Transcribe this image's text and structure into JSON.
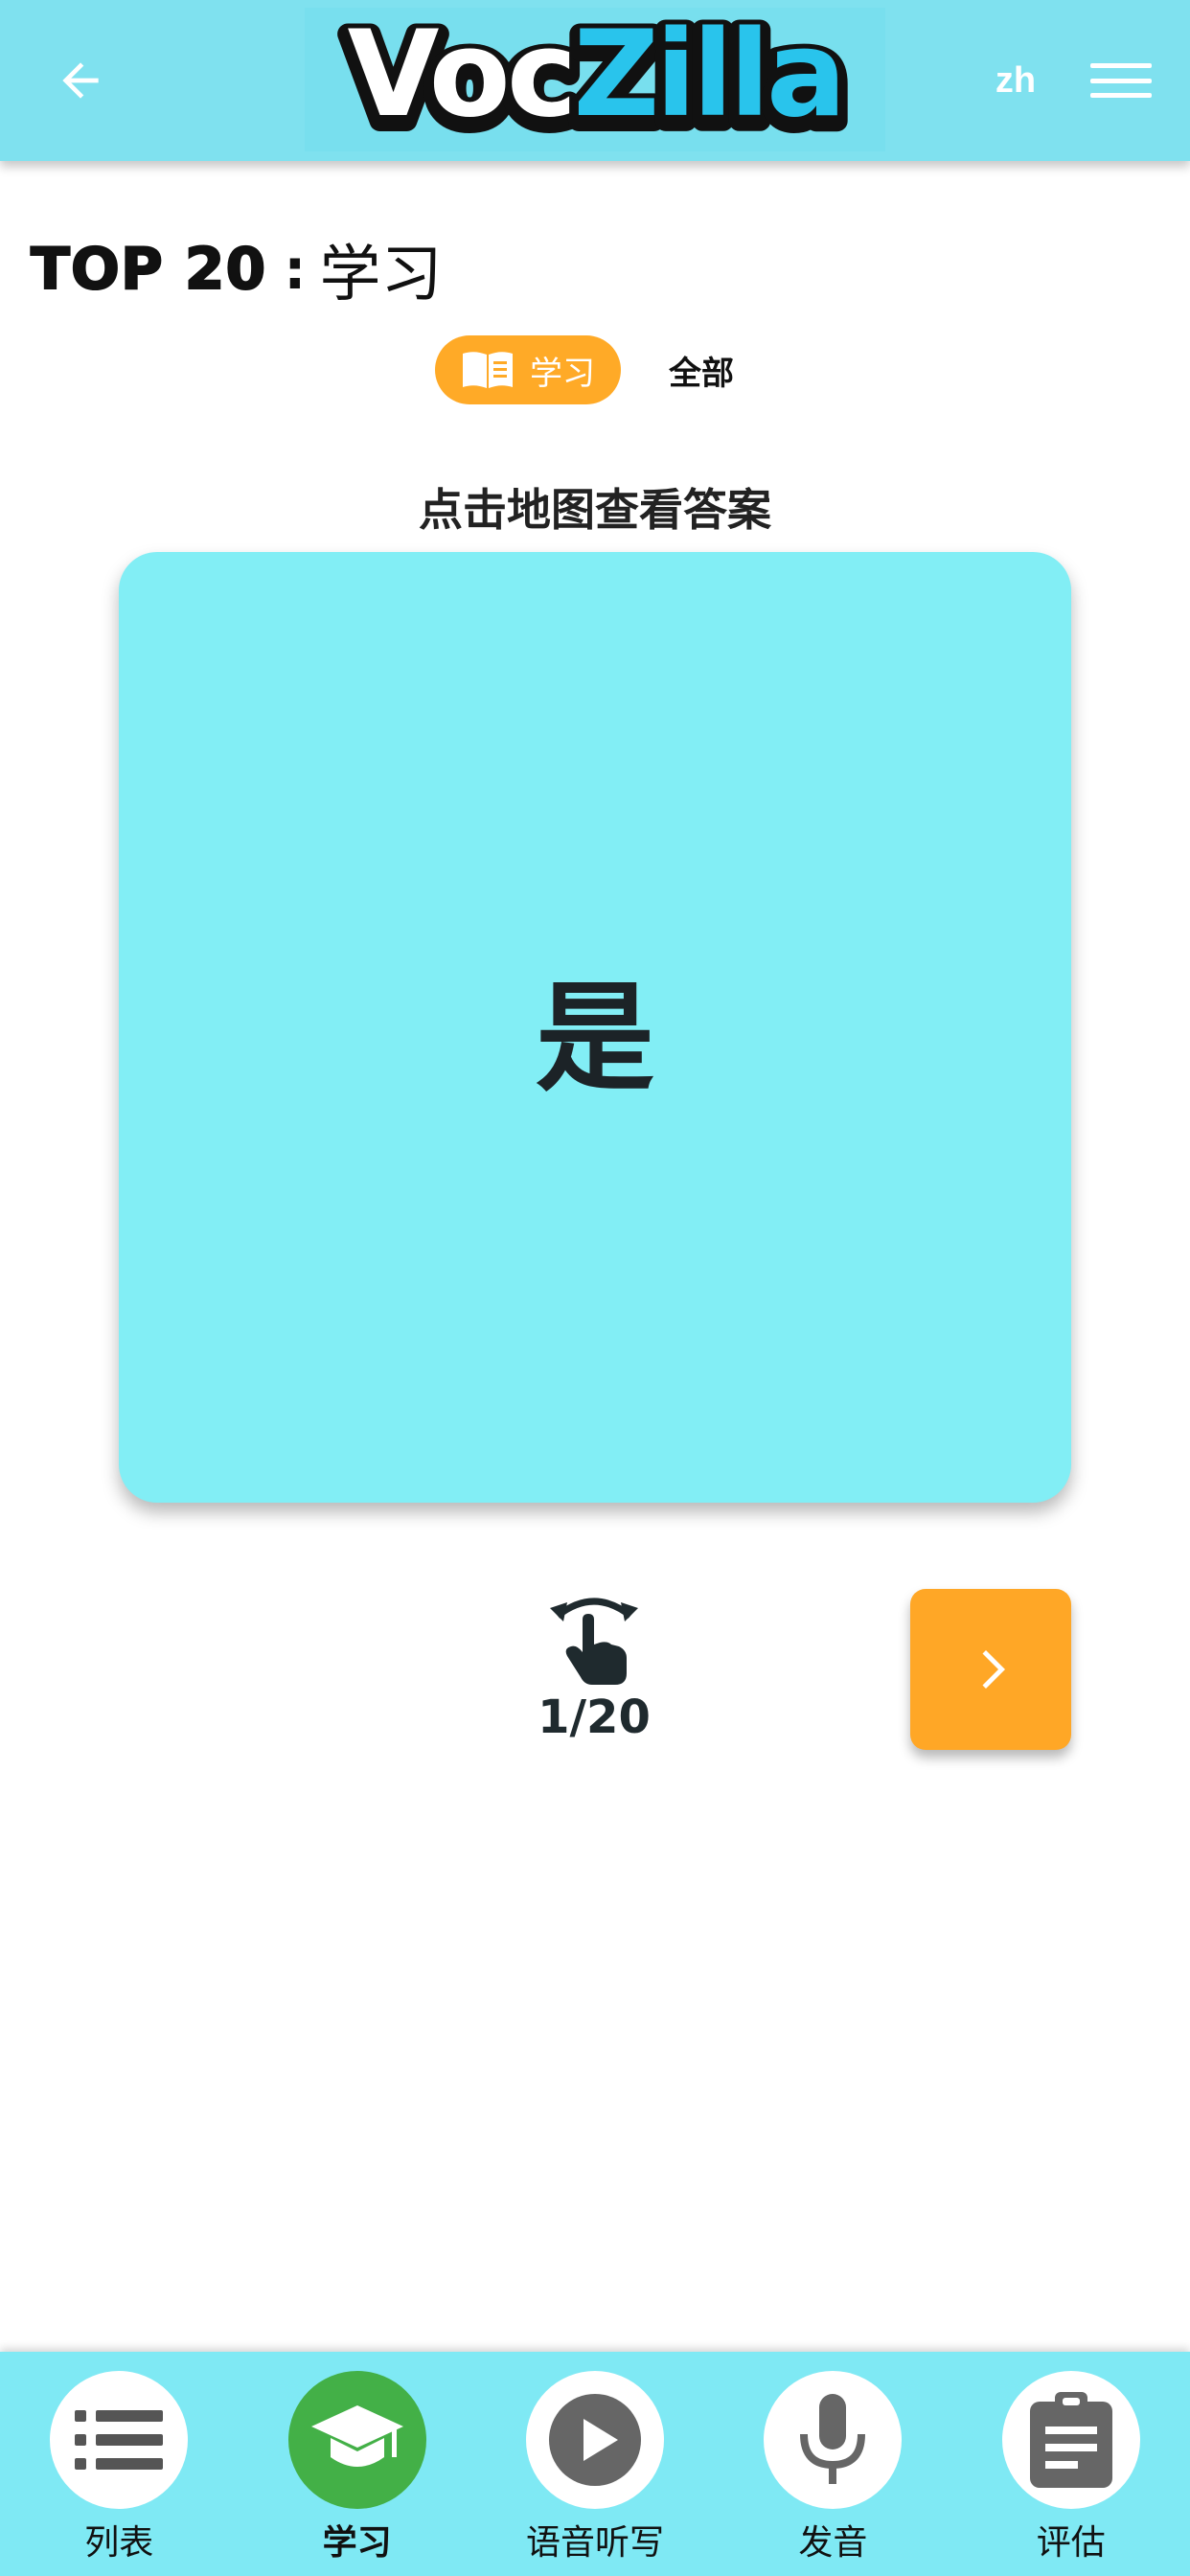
{
  "header": {
    "logo_text": "VocZilla",
    "language": "zh",
    "back_icon": "arrow-left-icon",
    "menu_icon": "hamburger-menu-icon"
  },
  "page": {
    "heading_prefix": "TOP 20",
    "heading_separator": ":",
    "heading_title": "学习"
  },
  "mode_switch": {
    "active_label": "学习",
    "active_icon": "book-open-icon",
    "other_label": "全部"
  },
  "card": {
    "hint": "点击地图查看答案",
    "word": "是",
    "counter": "1/20",
    "flip_icon": "tap-flip-icon",
    "next_icon": "chevron-right-icon"
  },
  "bottom_nav": [
    {
      "label": "列表",
      "icon": "list-icon",
      "active": false
    },
    {
      "label": "学习",
      "icon": "graduation-cap-icon",
      "active": true
    },
    {
      "label": "语音听写",
      "icon": "play-icon",
      "active": false
    },
    {
      "label": "发音",
      "icon": "microphone-icon",
      "active": false
    },
    {
      "label": "评估",
      "icon": "clipboard-icon",
      "active": false
    }
  ],
  "colors": {
    "header_bg": "#7fe1ef",
    "accent_orange": "#ffa726",
    "card_bg": "#82eef5",
    "nav_active": "#43b047",
    "logo_blue": "#29c4ec"
  }
}
